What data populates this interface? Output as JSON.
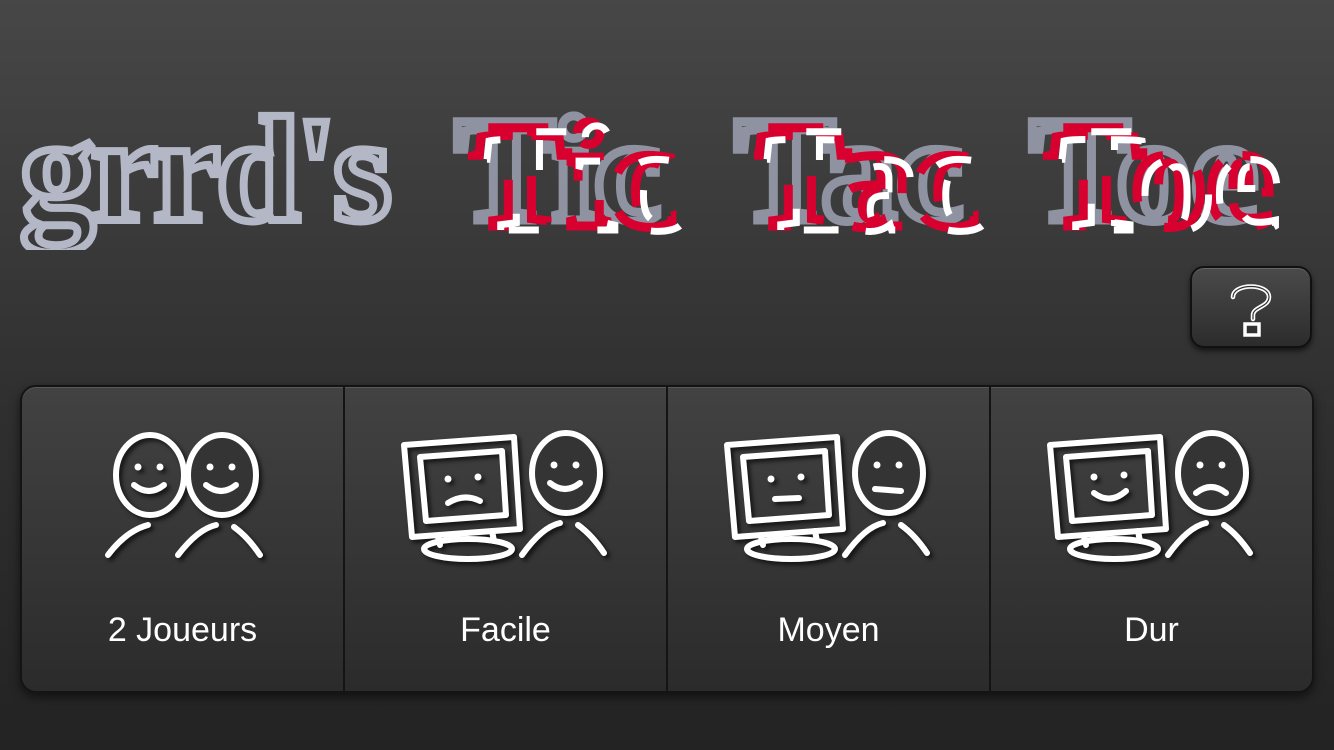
{
  "app": {
    "title_owner": "grrd's",
    "title_word1": "Tic",
    "title_word2": "Tac",
    "title_word3": "Toe"
  },
  "help_button": {
    "label": "?"
  },
  "modes": [
    {
      "label": "2 Joueurs",
      "icon": "two-players-icon"
    },
    {
      "label": "Facile",
      "icon": "computer-easy-icon"
    },
    {
      "label": "Moyen",
      "icon": "computer-medium-icon"
    },
    {
      "label": "Dur",
      "icon": "computer-hard-icon"
    }
  ],
  "colors": {
    "background": "#2f2f2f",
    "title_grey": "#b4b8c6",
    "title_red": "#d8002e",
    "title_white": "#ffffff",
    "icon_stroke": "#ffffff",
    "text": "#ffffff"
  }
}
